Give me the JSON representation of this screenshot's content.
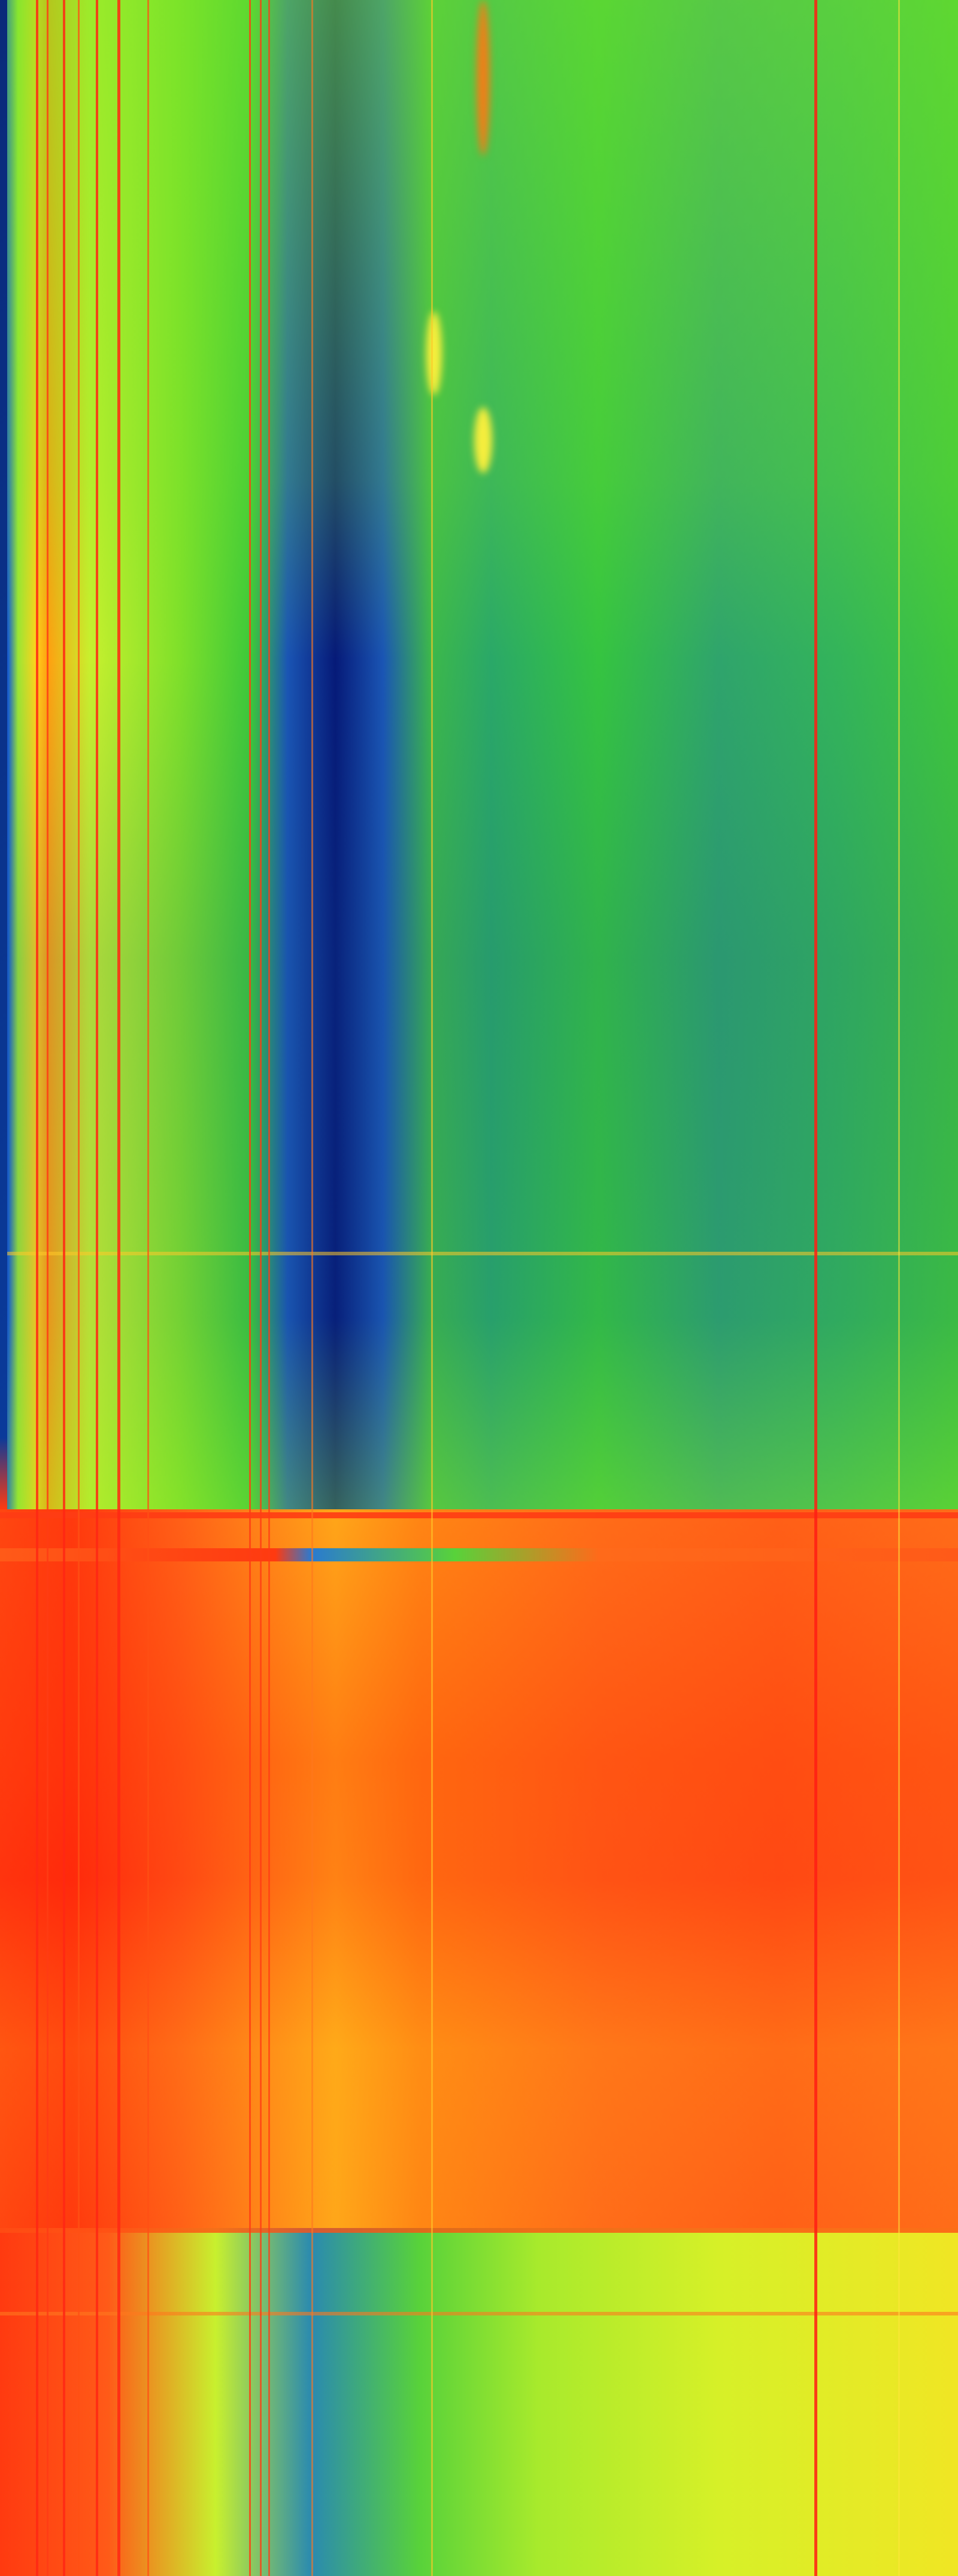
{
  "image": {
    "description_colors": {
      "cool_low": "#061a78",
      "cool_mid": "#1a55b4",
      "green": "#3cc83a",
      "yellow": "#ffd21c",
      "hot": "#ff3a10"
    }
  }
}
